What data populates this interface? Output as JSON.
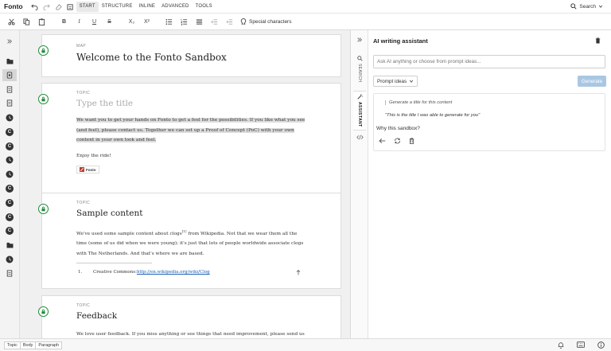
{
  "app": {
    "logo": "Fonto",
    "tabs": [
      "START",
      "STRUCTURE",
      "INLINE",
      "ADVANCED",
      "TOOLS"
    ],
    "active_tab": "START",
    "search_label": "Search"
  },
  "toolbar": {
    "bold": "B",
    "italic": "I",
    "underline": "U",
    "strike": "S",
    "subscript": "X₂",
    "superscript": "X²",
    "special_characters": "Special characters"
  },
  "editor": {
    "map_card": {
      "kind": "MAP",
      "title": "Welcome to the Fonto Sandbox"
    },
    "topic1": {
      "kind": "TOPIC",
      "title_placeholder": "Type the title",
      "para1_lines": [
        "We want you to get your hands on Fonto to get a feel for the possibilities. If you like what you see",
        "(and feel), please contact us. Together we can set up a Proof of Concept (PoC) with your own",
        "content in your own look and feel."
      ],
      "para2": "Enjoy the ride!",
      "badge": "Fonto"
    },
    "topic2": {
      "kind": "TOPIC",
      "title": "Sample content",
      "lines": {
        "l1_before": "We've used some sample content about clogs",
        "l1_ref": "[1]",
        "l1_after": " from Wikipedia. Not that we wear them all the",
        "l2": "time (some of us did when we were young); it's just that lots of people worldwide associate clogs",
        "l3": "with The Netherlands. And that's where we are based."
      },
      "footnote_num": "1.",
      "footnote_text": "Creative Commons: ",
      "footnote_link": "http://en.wikipedia.org/wiki/Clog"
    },
    "topic3": {
      "kind": "TOPIC",
      "title": "Feedback",
      "line": "We love user feedback. If you miss anything or see things that need improvement, please send us"
    }
  },
  "side_panel": {
    "tabs": [
      "SEARCH",
      "ASSISTANT"
    ],
    "active_tab": "ASSISTANT",
    "title": "AI writing assistant",
    "ask_placeholder": "Ask AI anything or choose from prompt ideas...",
    "prompt_ideas_label": "Prompt ideas",
    "generate_label": "Generate",
    "answer": {
      "prompt": "Generate a title for this content",
      "quote": "\"This is the title I was able to generate for you\"",
      "question": "Why this sandbox?"
    }
  },
  "statusbar": {
    "breadcrumbs": [
      "Topic",
      "Body",
      "Paragraph"
    ]
  },
  "colors": {
    "accent": "#1f8a3a",
    "generate_button": "#a9c7e3",
    "link": "#1a5fb4",
    "highlight": "#dcdcdc"
  }
}
